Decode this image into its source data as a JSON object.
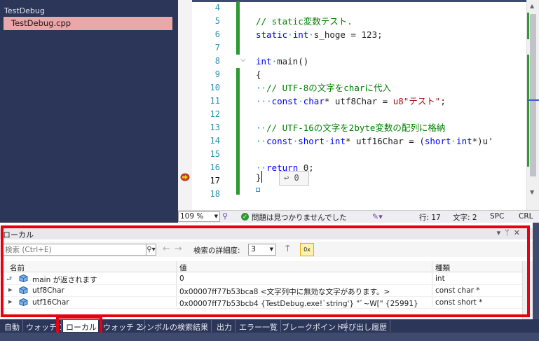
{
  "solution": {
    "project": "TestDebug",
    "selected_file": "TestDebug.cpp"
  },
  "editor": {
    "line_numbers": [
      "4",
      "5",
      "6",
      "7",
      "8",
      "9",
      "10",
      "11",
      "12",
      "13",
      "14",
      "15",
      "16",
      "17",
      "18"
    ],
    "code": {
      "l5_comment": "// static変数テスト.",
      "l6_kw1": "static",
      "l6_kw2": "int",
      "l6_rest": "s_hoge = 123;",
      "l8_kw": "int",
      "l8_rest": "main()",
      "l9": "{",
      "l10_comment": "// UTF-8の文字をcharに代入",
      "l11_kw1": "const",
      "l11_kw2": "char",
      "l11_rest": "* utf8Char = ",
      "l11_str1": "u8",
      "l11_str2": "\"テスト\"",
      "l11_end": ";",
      "l13_comment": "// UTF-16の文字を2byte変数の配列に格納",
      "l14_kw1": "const",
      "l14_kw2": "short",
      "l14_kw3": "int",
      "l14_mid": "* utf16Char = (",
      "l14_kw4": "short",
      "l14_kw5": "int",
      "l14_end": "*)u'",
      "l16_kw": "return",
      "l16_rest": " 0;",
      "l17": "}"
    },
    "inline_hint": "↩ 0"
  },
  "editor_status": {
    "zoom": "109 %",
    "issues": "問題は見つかりませんでした",
    "line": "行: 17",
    "col": "文字: 2",
    "spc": "SPC",
    "crlf": "CRL"
  },
  "locals": {
    "title": "ローカル",
    "search_placeholder": "検索 (Ctrl+E)",
    "depth_label": "検索の詳細度:",
    "depth_value": "3",
    "hex_label": "0x",
    "columns": {
      "name": "名前",
      "value": "値",
      "type": "種類"
    },
    "rows": [
      {
        "name": "main が返されます",
        "value": "0",
        "type": "int"
      },
      {
        "name": "utf8Char",
        "value": "0x00007ff77b53bca8 <文字列中に無効な文字があります。>",
        "type": "const char *"
      },
      {
        "name": "utf16Char",
        "value": "0x00007ff77b53bcb4 {TestDebug.exe!`string'} \"ﾞ~W[\" {25991}",
        "type": "const short *"
      }
    ]
  },
  "bottom_tabs": [
    "自動",
    "ウォッチ 1",
    "ローカル",
    "ウォッチ 2",
    "シンボルの検索結果",
    "出力",
    "エラー一覧",
    "ブレークポイント",
    "呼び出し履歴"
  ],
  "colors": {
    "highlight_frame": "#e60012",
    "change_bar": "#2e9a34",
    "theme_dark": "#2b3658"
  }
}
